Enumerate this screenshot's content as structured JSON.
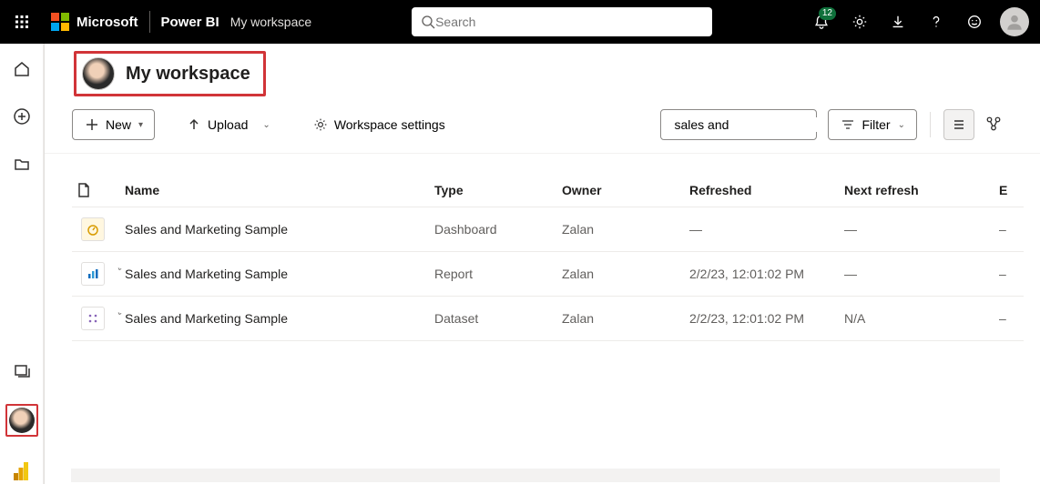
{
  "header": {
    "brand_text": "Microsoft",
    "product_text": "Power BI",
    "breadcrumb": "My workspace",
    "search_placeholder": "Search",
    "notification_count": "12"
  },
  "workspace": {
    "title": "My workspace"
  },
  "commands": {
    "new_label": "New",
    "upload_label": "Upload",
    "settings_label": "Workspace settings",
    "filter_label": "Filter",
    "search_value": "sales and"
  },
  "table": {
    "headers": {
      "name": "Name",
      "type": "Type",
      "owner": "Owner",
      "refreshed": "Refreshed",
      "next": "Next refresh",
      "end": "E"
    },
    "rows": [
      {
        "icon": "dashboard",
        "name": "Sales and Marketing Sample",
        "type": "Dashboard",
        "owner": "Zalan",
        "refreshed": "—",
        "next": "—",
        "end": "–",
        "caret": false
      },
      {
        "icon": "report",
        "name": "Sales and Marketing Sample",
        "type": "Report",
        "owner": "Zalan",
        "refreshed": "2/2/23, 12:01:02 PM",
        "next": "—",
        "end": "–",
        "caret": true
      },
      {
        "icon": "dataset",
        "name": "Sales and Marketing Sample",
        "type": "Dataset",
        "owner": "Zalan",
        "refreshed": "2/2/23, 12:01:02 PM",
        "next": "N/A",
        "end": "–",
        "caret": true
      }
    ]
  }
}
